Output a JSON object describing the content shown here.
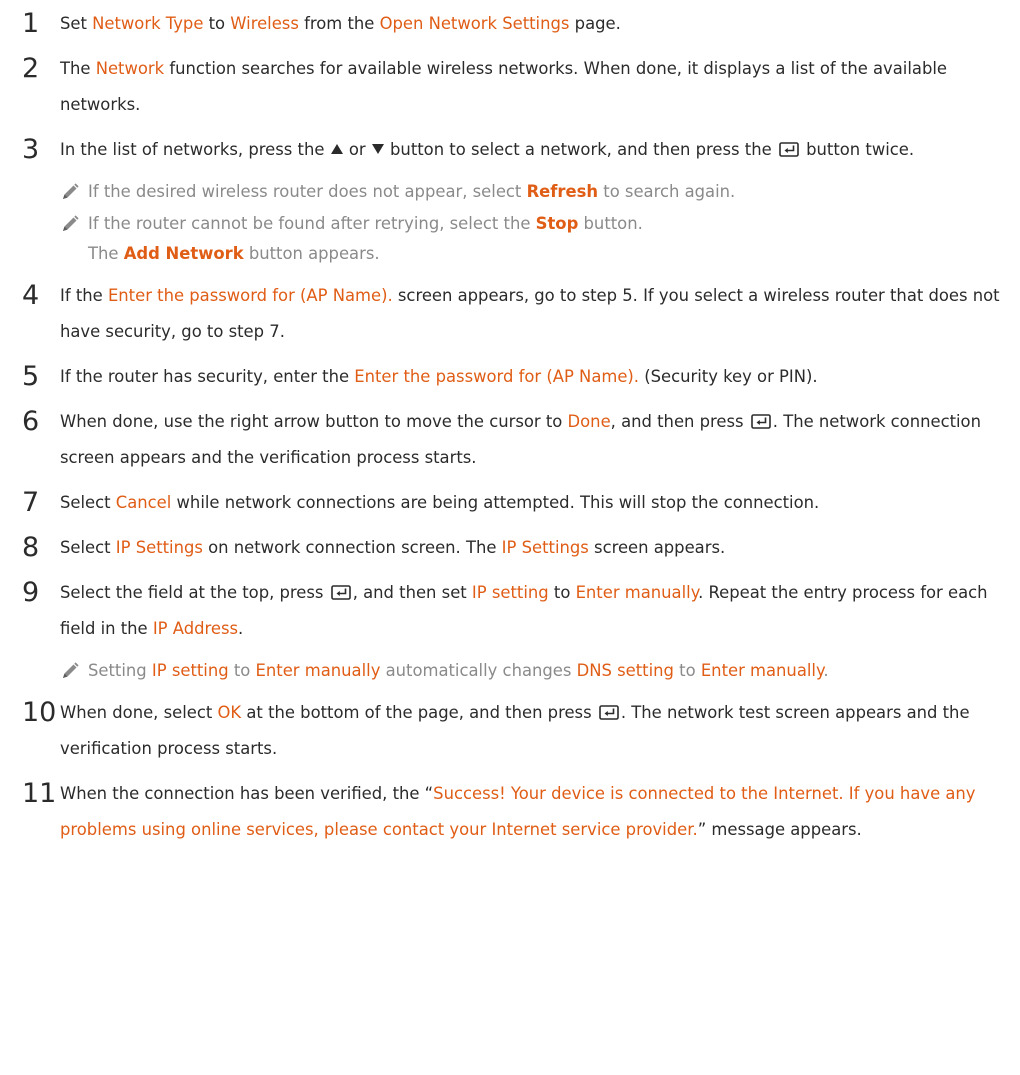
{
  "steps": [
    {
      "num": "1",
      "parts": [
        {
          "t": "Set "
        },
        {
          "h": "Network Type"
        },
        {
          "t": " to "
        },
        {
          "h": "Wireless"
        },
        {
          "t": " from the "
        },
        {
          "h": "Open Network Settings"
        },
        {
          "t": " page."
        }
      ]
    },
    {
      "num": "2",
      "parts": [
        {
          "t": "The "
        },
        {
          "h": "Network"
        },
        {
          "t": " function searches for available wireless networks. When done, it displays a list of the available networks."
        }
      ]
    },
    {
      "num": "3",
      "parts": [
        {
          "t": "In the list of networks, press the "
        },
        {
          "icon": "up"
        },
        {
          "t": " or "
        },
        {
          "icon": "down"
        },
        {
          "t": " button to select a network, and then press the "
        },
        {
          "icon": "enter"
        },
        {
          "t": " button twice."
        }
      ]
    },
    {
      "num": "4",
      "parts": [
        {
          "t": "If the "
        },
        {
          "h": "Enter the password for (AP Name)."
        },
        {
          "t": " screen appears, go to step 5. If you select a wireless router that does not have security, go to step 7."
        }
      ]
    },
    {
      "num": "5",
      "parts": [
        {
          "t": "If the router has security, enter the "
        },
        {
          "h": "Enter the password for (AP Name)."
        },
        {
          "t": " (Security key or PIN)."
        }
      ]
    },
    {
      "num": "6",
      "parts": [
        {
          "t": "When done, use the right arrow button to move the cursor to "
        },
        {
          "h": "Done"
        },
        {
          "t": ", and then press "
        },
        {
          "icon": "enter"
        },
        {
          "t": ". The network connection screen appears and the verification process starts."
        }
      ]
    },
    {
      "num": "7",
      "parts": [
        {
          "t": "Select "
        },
        {
          "h": "Cancel"
        },
        {
          "t": " while network connections are being attempted. This will stop the connection."
        }
      ]
    },
    {
      "num": "8",
      "parts": [
        {
          "t": "Select "
        },
        {
          "h": "IP Settings"
        },
        {
          "t": " on network connection screen. The "
        },
        {
          "h": "IP Settings"
        },
        {
          "t": " screen appears."
        }
      ]
    },
    {
      "num": "9",
      "parts": [
        {
          "t": "Select the field at the top, press "
        },
        {
          "icon": "enter"
        },
        {
          "t": ", and then set "
        },
        {
          "h": "IP setting"
        },
        {
          "t": " to "
        },
        {
          "h": "Enter manually"
        },
        {
          "t": ". Repeat the entry process for each field in the "
        },
        {
          "h": "IP Address"
        },
        {
          "t": "."
        }
      ]
    },
    {
      "num": "10",
      "parts": [
        {
          "t": "When done, select "
        },
        {
          "h": "OK"
        },
        {
          "t": " at the bottom of the page, and then press "
        },
        {
          "icon": "enter"
        },
        {
          "t": ". The network test screen appears and the verification process starts."
        }
      ]
    },
    {
      "num": "11",
      "parts": [
        {
          "t": "When the connection has been verified, the “"
        },
        {
          "h": "Success! Your device is connected to the Internet. If you have any problems using online services, please contact your Internet service provider."
        },
        {
          "t": "” message appears."
        }
      ]
    }
  ],
  "notes": {
    "step3_a": [
      {
        "t": "If the desired wireless router does not appear, select "
      },
      {
        "hb": "Refresh"
      },
      {
        "t": " to search again."
      }
    ],
    "step3_b": [
      {
        "t": "If the router cannot be found after retrying, select the "
      },
      {
        "hb": "Stop"
      },
      {
        "t": " button."
      },
      {
        "br": true
      },
      {
        "t": "The "
      },
      {
        "hb": "Add Network"
      },
      {
        "t": " button appears."
      }
    ],
    "step9_a": [
      {
        "t": "Setting "
      },
      {
        "h": "IP setting"
      },
      {
        "t": " to "
      },
      {
        "h": "Enter manually"
      },
      {
        "t": " automatically changes "
      },
      {
        "h": "DNS setting"
      },
      {
        "t": " to "
      },
      {
        "h": "Enter manually"
      },
      {
        "t": "."
      }
    ]
  },
  "colors": {
    "accent": "#e05d16",
    "body": "#2b2b2b",
    "note": "#8a8a8a"
  },
  "icons": {
    "note": "pencil-icon",
    "enter": "enter-button-icon",
    "up": "up-triangle-icon",
    "down": "down-triangle-icon"
  }
}
